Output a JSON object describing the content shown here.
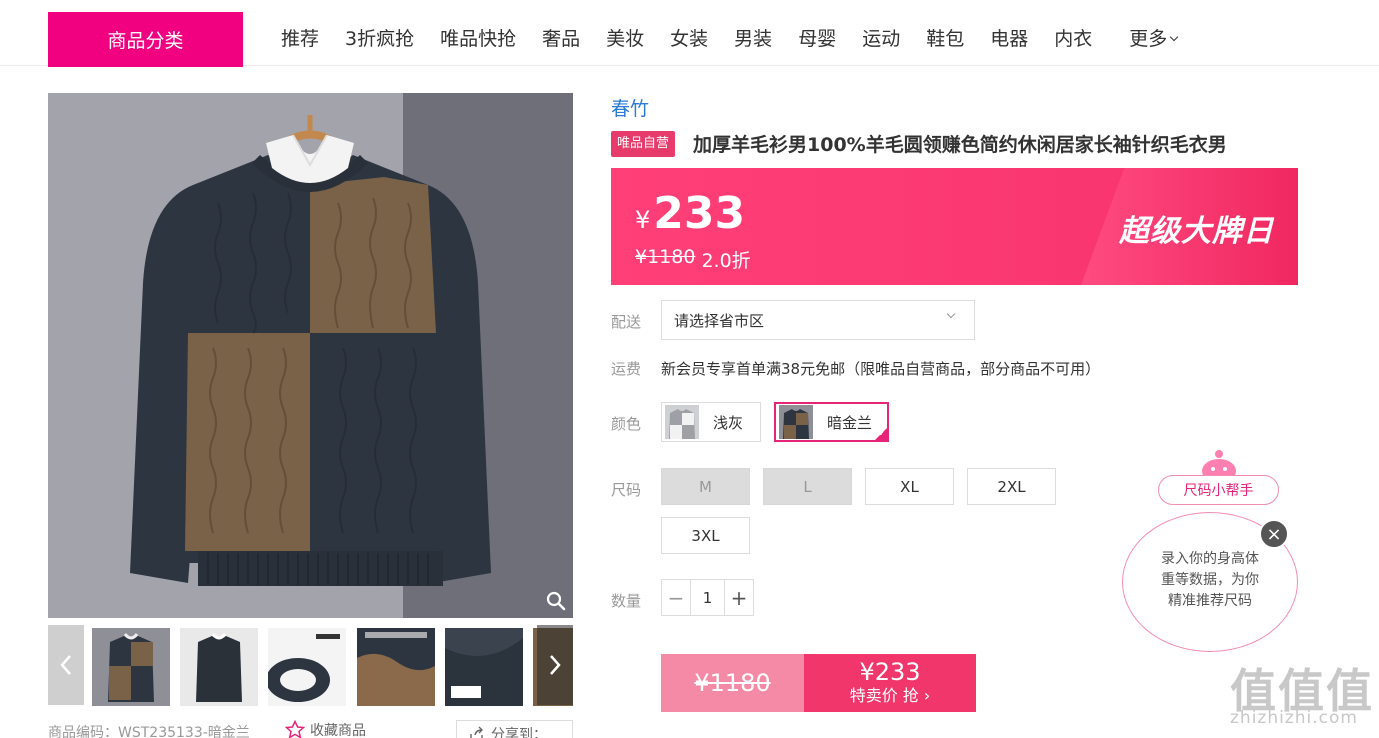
{
  "nav": {
    "category_button": "商品分类",
    "items": [
      "推荐",
      "3折疯抢",
      "唯品快抢",
      "奢品",
      "美妆",
      "女装",
      "男装",
      "母婴",
      "运动",
      "鞋包",
      "电器",
      "内衣"
    ],
    "more": "更多"
  },
  "gallery": {
    "product_code": "商品编码：WST235133-暗金兰",
    "favorite": "收藏商品",
    "share": "分享到："
  },
  "product": {
    "brand": "春竹",
    "badge": "唯品自营",
    "title": "加厚羊毛衫男100%羊毛圆领赚色简约休闲居家长袖针织毛衣男"
  },
  "price": {
    "currency": "¥",
    "current": "233",
    "original": "¥1180",
    "discount": "2.0折",
    "promo": "超级大牌日"
  },
  "delivery": {
    "label": "配送",
    "placeholder": "请选择省市区"
  },
  "freight": {
    "label": "运费",
    "text": "新会员专享首单满38元免邮（限唯品自营商品，部分商品不可用）"
  },
  "colors": {
    "label": "颜色",
    "options": [
      {
        "name": "浅灰",
        "selected": false
      },
      {
        "name": "暗金兰",
        "selected": true
      }
    ]
  },
  "sizes": {
    "label": "尺码",
    "options": [
      {
        "name": "M",
        "available": false
      },
      {
        "name": "L",
        "available": false
      },
      {
        "name": "XL",
        "available": true
      },
      {
        "name": "2XL",
        "available": true
      },
      {
        "name": "3XL",
        "available": true
      }
    ]
  },
  "quantity": {
    "label": "数量",
    "minus": "−",
    "value": "1",
    "plus": "+"
  },
  "buy": {
    "original": "¥1180",
    "price": "¥233",
    "action": "特卖价 抢"
  },
  "size_helper": {
    "tag": "尺码小帮手",
    "line1": "录入你的身高体",
    "line2": "重等数据，为你",
    "line3": "精准推荐尺码",
    "close": "×"
  },
  "watermark": {
    "text": "值值值",
    "url": "zhizhizhi.com"
  },
  "colors_theme": {
    "brand_pink": "#f10180",
    "price_red": "#f0366b",
    "link_blue": "#2b7bd6"
  }
}
